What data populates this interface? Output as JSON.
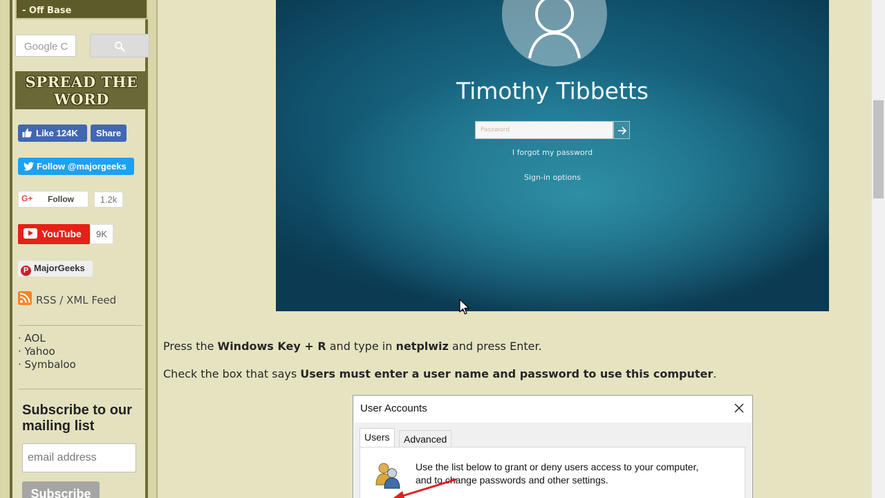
{
  "sidebar": {
    "header_link": "- Off Base",
    "search": {
      "placeholder": "Google C",
      "button_icon": "search-icon"
    },
    "spread_banner": {
      "line1": "SPREAD THE",
      "line2": "WORD"
    },
    "social": {
      "facebook": {
        "like_label": "Like 124K",
        "share_label": "Share",
        "color": "#4267b2"
      },
      "twitter": {
        "label": "Follow @majorgeeks",
        "color": "#1da1f2"
      },
      "google_plus": {
        "label": "Follow",
        "count": "1.2k",
        "icon": "G+"
      },
      "youtube": {
        "label": "YouTube",
        "count": "9K",
        "color": "#e62117"
      },
      "pinterest": {
        "label": "MajorGeeks",
        "color": "#cb2027"
      },
      "rss": {
        "label": "RSS / XML Feed",
        "color": "#f78422"
      }
    },
    "bookmarks": [
      "· AOL",
      "· Yahoo",
      "· Symbaloo"
    ],
    "subscribe": {
      "title": "Subscribe to our mailing list",
      "email_placeholder": "email address",
      "button_label": "Subscribe"
    }
  },
  "login_screenshot": {
    "user_name": "Timothy Tibbetts",
    "password_placeholder": "Password",
    "forgot_link": "I forgot my password",
    "signin_options": "Sign-in options"
  },
  "article": {
    "step1": {
      "pre": "Press the ",
      "key": "Windows Key + R",
      "mid": " and type in ",
      "cmd": "netplwiz",
      "post": " and press Enter."
    },
    "step2": {
      "pre": "Check the box that says ",
      "bold": "Users must enter a user name and password to use this computer",
      "post": "."
    }
  },
  "user_accounts_dialog": {
    "title": "User Accounts",
    "tabs": [
      "Users",
      "Advanced"
    ],
    "description_line1": "Use the list below to grant or deny users access to your computer,",
    "description_line2": "and to change passwords and other settings."
  },
  "colors": {
    "page_bg": "#e6e4c0",
    "sidebar_dark": "#6b6838",
    "annotation_arrow": "#e02020"
  }
}
